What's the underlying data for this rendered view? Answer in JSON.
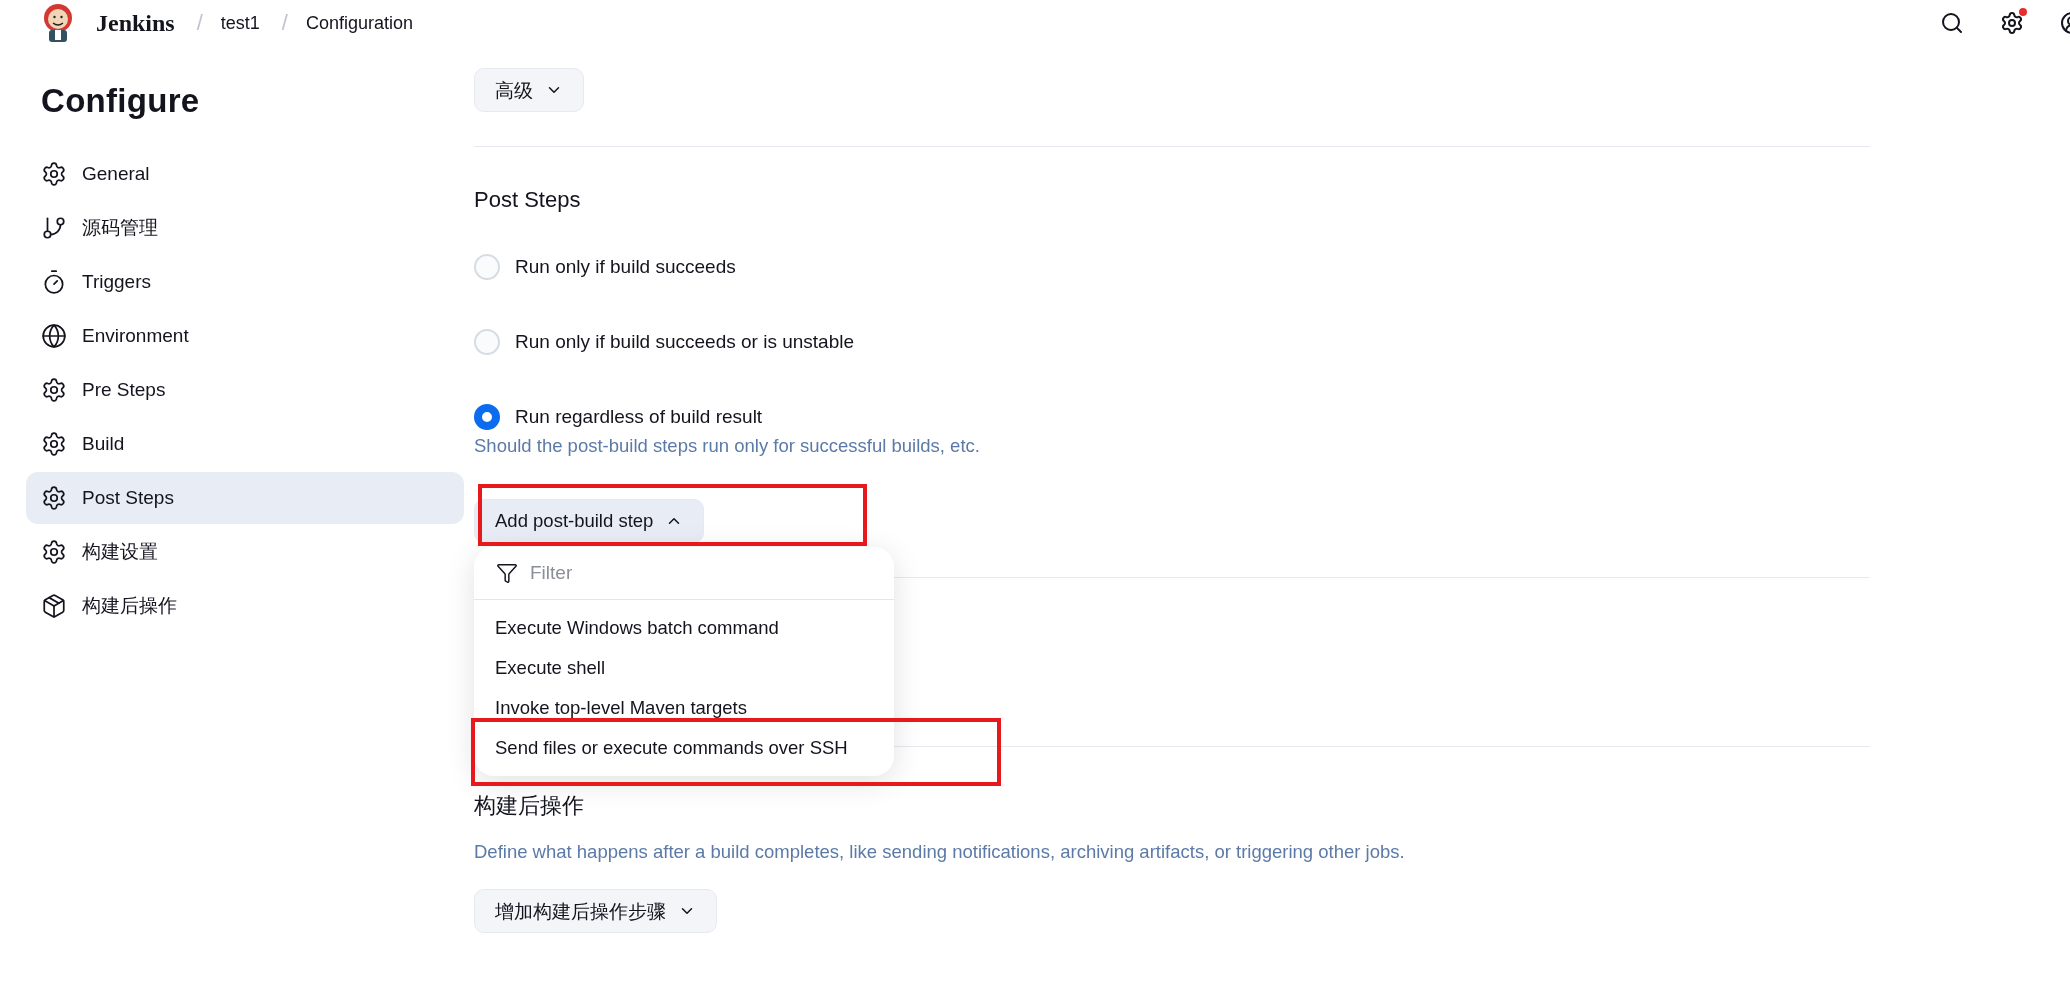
{
  "header": {
    "brand": "Jenkins",
    "breadcrumbs": [
      {
        "label": "test1"
      },
      {
        "label": "Configuration"
      }
    ],
    "separator": "/",
    "notification": true
  },
  "sidebar": {
    "title": "Configure",
    "items": [
      {
        "label": "General",
        "selected": false
      },
      {
        "label": "源码管理",
        "selected": false
      },
      {
        "label": "Triggers",
        "selected": false
      },
      {
        "label": "Environment",
        "selected": false
      },
      {
        "label": "Pre Steps",
        "selected": false
      },
      {
        "label": "Build",
        "selected": false
      },
      {
        "label": "Post Steps",
        "selected": true
      },
      {
        "label": "构建设置",
        "selected": false
      },
      {
        "label": "构建后操作",
        "selected": false
      }
    ]
  },
  "advanced_button": {
    "label": "高级"
  },
  "post_steps": {
    "title": "Post Steps",
    "options": [
      {
        "label": "Run only if build succeeds",
        "selected": false
      },
      {
        "label": "Run only if build succeeds or is unstable",
        "selected": false
      },
      {
        "label": "Run regardless of build result",
        "selected": true
      }
    ],
    "help": "Should the post-build steps run only for successful builds, etc.",
    "add_button": {
      "label": "Add post-build step",
      "expanded": true
    }
  },
  "dropdown": {
    "filter_placeholder": "Filter",
    "items": [
      {
        "label": "Execute Windows batch command"
      },
      {
        "label": "Execute shell"
      },
      {
        "label": "Invoke top-level Maven targets"
      },
      {
        "label": "Send files or execute commands over SSH"
      }
    ]
  },
  "post_build": {
    "title": "构建后操作",
    "description": "Define what happens after a build completes, like sending notifications, archiving artifacts, or triggering other jobs.",
    "add_button": {
      "label": "增加构建后操作步骤",
      "expanded": false
    }
  },
  "annotations": [
    {
      "kind": "frame"
    },
    {
      "kind": "frame"
    }
  ]
}
